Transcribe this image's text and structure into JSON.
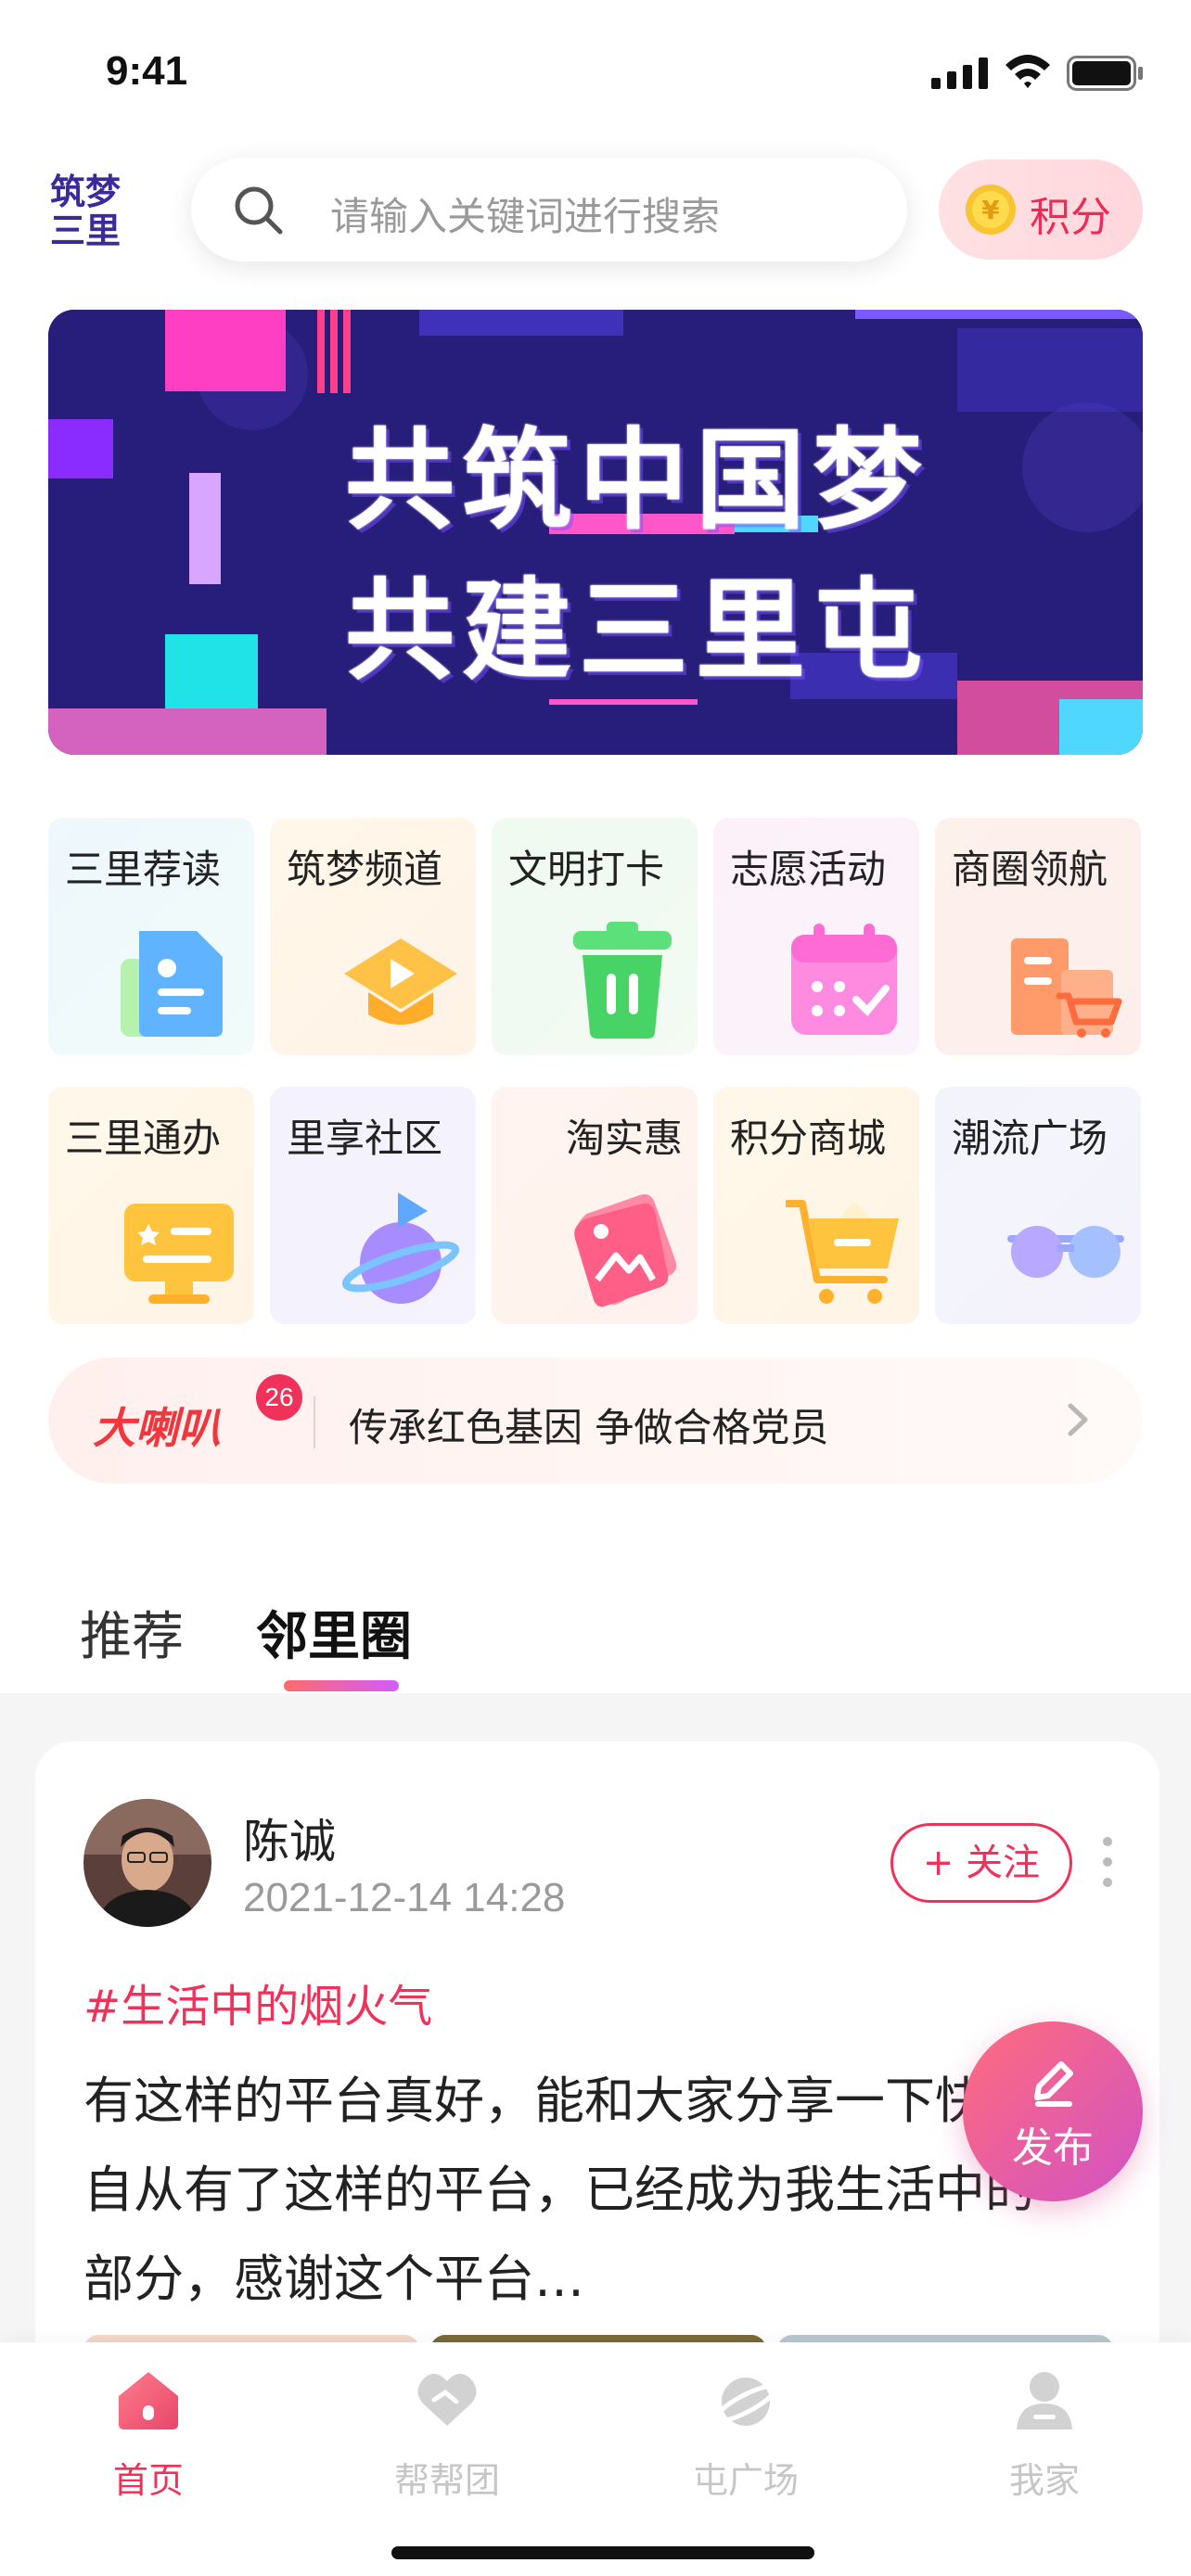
{
  "status_bar": {
    "time": "9:41"
  },
  "header": {
    "logo_text": "筑梦三里",
    "search_placeholder": "请输入关键词进行搜索",
    "points_label": "积分"
  },
  "banner": {
    "line1": "共筑中国梦",
    "line2": "共建三里屯"
  },
  "grid": [
    {
      "label": "三里荐读",
      "icon": "document-icon"
    },
    {
      "label": "筑梦频道",
      "icon": "play-cap-icon"
    },
    {
      "label": "文明打卡",
      "icon": "trash-bin-icon"
    },
    {
      "label": "志愿活动",
      "icon": "calendar-icon"
    },
    {
      "label": "商圈领航",
      "icon": "shop-cart-icon"
    },
    {
      "label": "三里通办",
      "icon": "monitor-icon"
    },
    {
      "label": "里享社区",
      "icon": "planet-icon"
    },
    {
      "label": "淘实惠",
      "icon": "price-tag-icon"
    },
    {
      "label": "积分商城",
      "icon": "shopping-cart-icon"
    },
    {
      "label": "潮流广场",
      "icon": "sunglasses-icon"
    }
  ],
  "notice": {
    "logo": "大喇叭",
    "badge": "26",
    "text": "传承红色基因 争做合格党员"
  },
  "tabs": [
    {
      "label": "推荐",
      "active": false
    },
    {
      "label": "邻里圈",
      "active": true
    }
  ],
  "post": {
    "author": "陈诚",
    "time": "2021-12-14 14:28",
    "follow_label": "+ 关注",
    "topic": "#生活中的烟火气",
    "body": "有这样的平台真好，能和大家分享一下快乐。自从有了这样的平台，已经成为我生活中的一部分，感谢这个平台…"
  },
  "publish": {
    "label": "发布"
  },
  "bottom_nav": [
    {
      "label": "首页",
      "active": true,
      "icon": "home-icon"
    },
    {
      "label": "帮帮团",
      "active": false,
      "icon": "heart-hands-icon"
    },
    {
      "label": "屯广场",
      "active": false,
      "icon": "planet-icon"
    },
    {
      "label": "我家",
      "active": false,
      "icon": "user-icon"
    }
  ],
  "colors": {
    "accent": "#f0325a",
    "banner_bg": "#271d7a"
  }
}
